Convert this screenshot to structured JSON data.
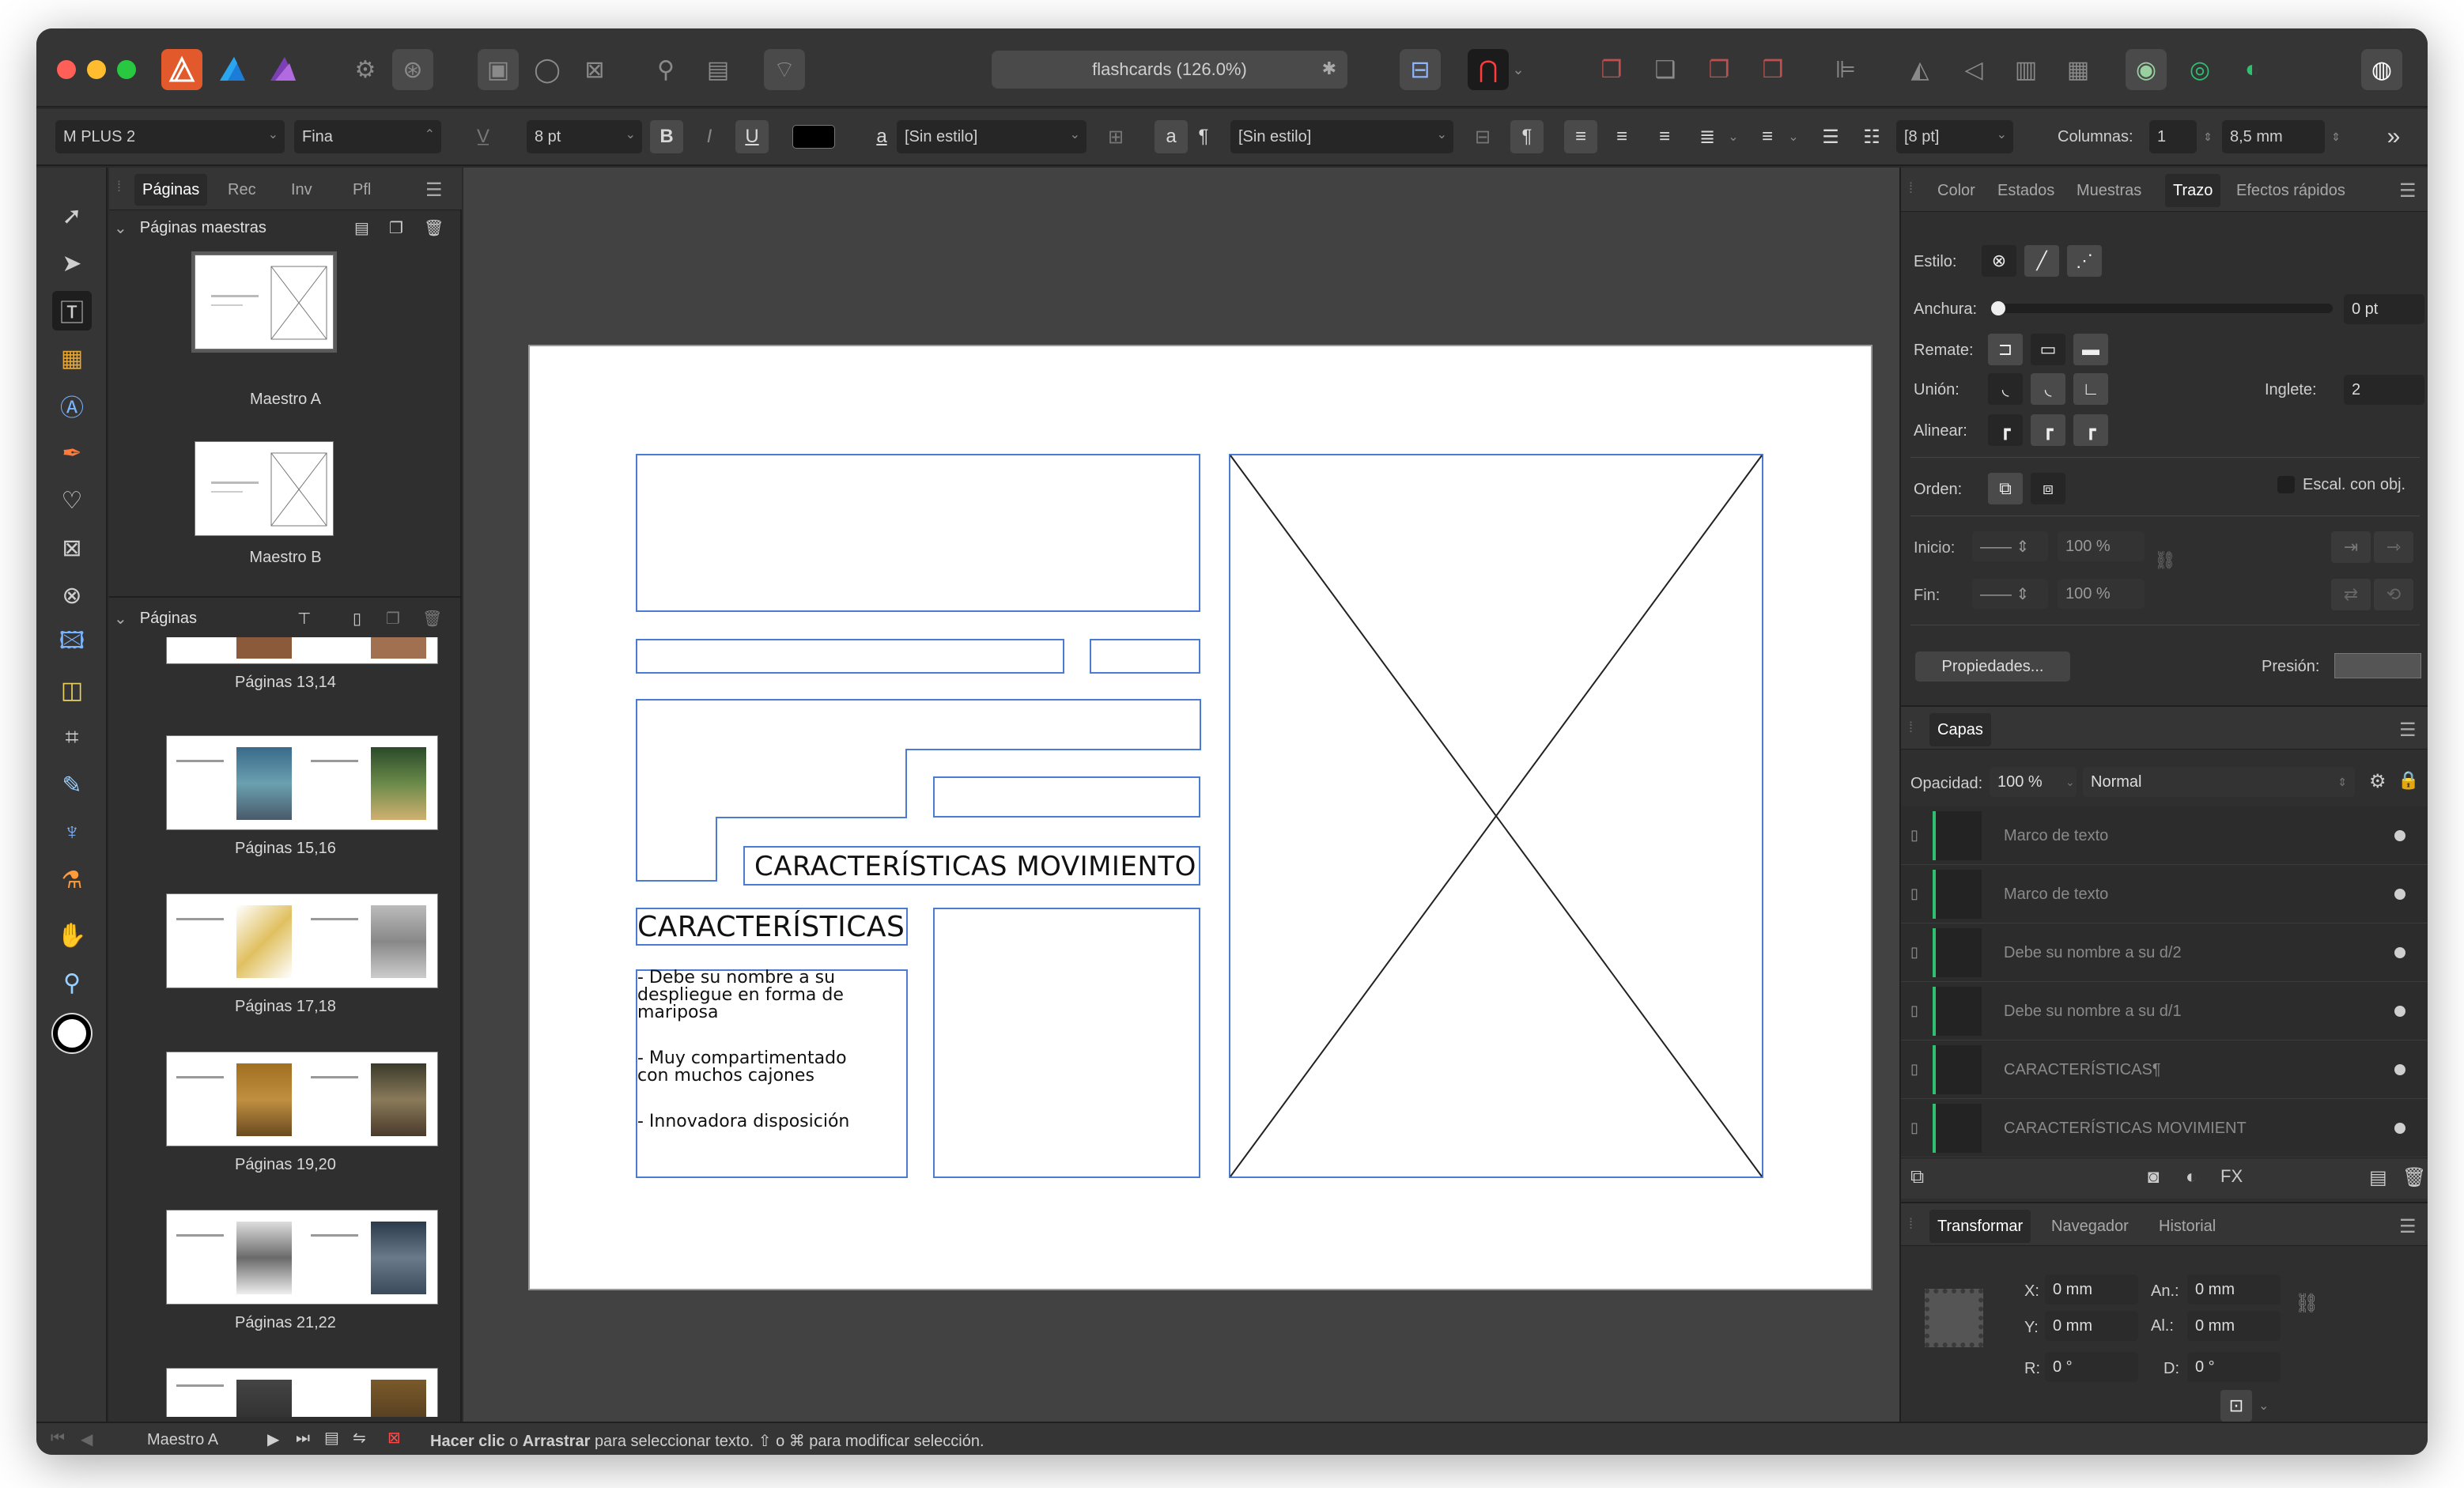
{
  "window": {
    "title": "flashcards (126.0%)"
  },
  "titlebar": {
    "traffic_colors": [
      "#ff5f57",
      "#febc2e",
      "#28c840"
    ],
    "apps": [
      "affinity-publisher-icon",
      "affinity-designer-icon",
      "affinity-photo-icon"
    ]
  },
  "context": {
    "font_family": "M PLUS 2",
    "font_style": "Fina",
    "font_size": "8 pt",
    "bold": "B",
    "italic": "I",
    "underline": "U",
    "char_style_glyph": "a",
    "char_style": "[Sin estilo]",
    "para_style_glyph": "a",
    "pilcrow": "¶",
    "para_style": "[Sin estilo]",
    "pilcrow2": "¶",
    "spacing": "[8 pt]",
    "columns_label": "Columnas:",
    "columns_value": "1",
    "gutter_value": "8,5 mm",
    "more": "»"
  },
  "pages_panel": {
    "tabs": [
      "Páginas",
      "Rec",
      "Inv",
      "Pfl"
    ],
    "masters_label": "Páginas maestras",
    "masters": [
      "Maestro A",
      "Maestro B"
    ],
    "pages_label": "Páginas",
    "spreads": [
      "Páginas 13,14",
      "Páginas 15,16",
      "Páginas 17,18",
      "Páginas 19,20",
      "Páginas 21,22"
    ]
  },
  "canvas": {
    "heading_movement": "CARACTERÍSTICAS MOVIMIENTO",
    "heading_features": "CARACTERÍSTICAS",
    "bullets": [
      "-      Debe su nombre a su despliegue en forma de mariposa",
      "-      Muy compartimentado con muchos cajones",
      "-      Innovadora disposición"
    ]
  },
  "stroke_panel": {
    "tabs": [
      "Color",
      "Estados",
      "Muestras",
      "Trazo",
      "Efectos rápidos"
    ],
    "style_label": "Estilo:",
    "width_label": "Anchura:",
    "width_value": "0 pt",
    "cap_label": "Remate:",
    "join_label": "Unión:",
    "miter_label": "Inglete:",
    "miter_value": "2",
    "align_label": "Alinear:",
    "order_label": "Orden:",
    "scale_label": "Escal. con obj.",
    "start_label": "Inicio:",
    "start_pct": "100 %",
    "end_label": "Fin:",
    "end_pct": "100 %",
    "properties_button": "Propiedades...",
    "pressure_label": "Presión:"
  },
  "layers_panel": {
    "tab": "Capas",
    "opacity_label": "Opacidad:",
    "opacity_value": "100 %",
    "blend_mode": "Normal",
    "layers": [
      "Marco de texto",
      "Marco de texto",
      "Debe su nombre a su d/2",
      "Debe su nombre a su d/1",
      "CARACTERÍSTICAS¶",
      "CARACTERÍSTICAS MOVIMIENT"
    ]
  },
  "transform_panel": {
    "tabs": [
      "Transformar",
      "Navegador",
      "Historial"
    ],
    "x_label": "X:",
    "x_value": "0 mm",
    "y_label": "Y:",
    "y_value": "0 mm",
    "w_label": "An.:",
    "w_value": "0 mm",
    "h_label": "Al.:",
    "h_value": "0 mm",
    "r_label": "R:",
    "r_value": "0 °",
    "s_label": "D:",
    "s_value": "0 °"
  },
  "status": {
    "master": "Maestro A",
    "hint_bold1": "Hacer clic",
    "hint_o1": "o",
    "hint_bold2": "Arrastrar",
    "hint_rest": "para seleccionar texto.",
    "hint_tail": "o ⌘ para modificar selección."
  },
  "colors": {
    "accent": "#4a7cd6",
    "active_green": "#2fbf71",
    "brand_orange": "#e25a2b"
  }
}
